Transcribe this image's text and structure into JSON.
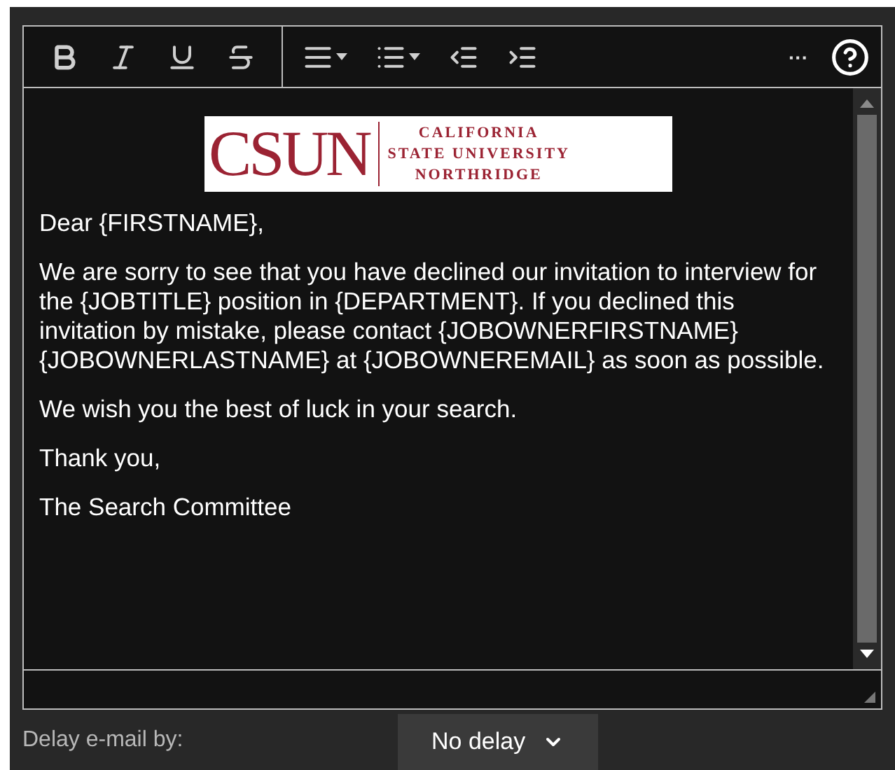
{
  "toolbar": {
    "buttons": [
      {
        "kind": "bold"
      },
      {
        "kind": "italic"
      },
      {
        "kind": "underline"
      },
      {
        "kind": "strike"
      },
      {
        "kind": "align",
        "dropdown": true
      },
      {
        "kind": "list",
        "dropdown": true
      },
      {
        "kind": "outdent"
      },
      {
        "kind": "indent"
      }
    ],
    "more": "···"
  },
  "logo": {
    "wordmark": "CSUN",
    "lines": [
      "CALIFORNIA",
      "STATE UNIVERSITY",
      "NORTHRIDGE"
    ]
  },
  "paragraphs": [
    "Dear {FIRSTNAME},",
    "We are sorry to see that you have declined our invitation to interview for the {JOBTITLE} position in {DEPARTMENT}. If you declined this invitation by mistake, please contact {JOBOWNERFIRSTNAME} {JOBOWNERLASTNAME} at {JOBOWNEREMAIL} as soon as possible.",
    "We wish you the best of luck in your search.",
    "Thank you,",
    "The Search Committee"
  ],
  "delay": {
    "label": "Delay e-mail by:",
    "value": "No delay"
  }
}
